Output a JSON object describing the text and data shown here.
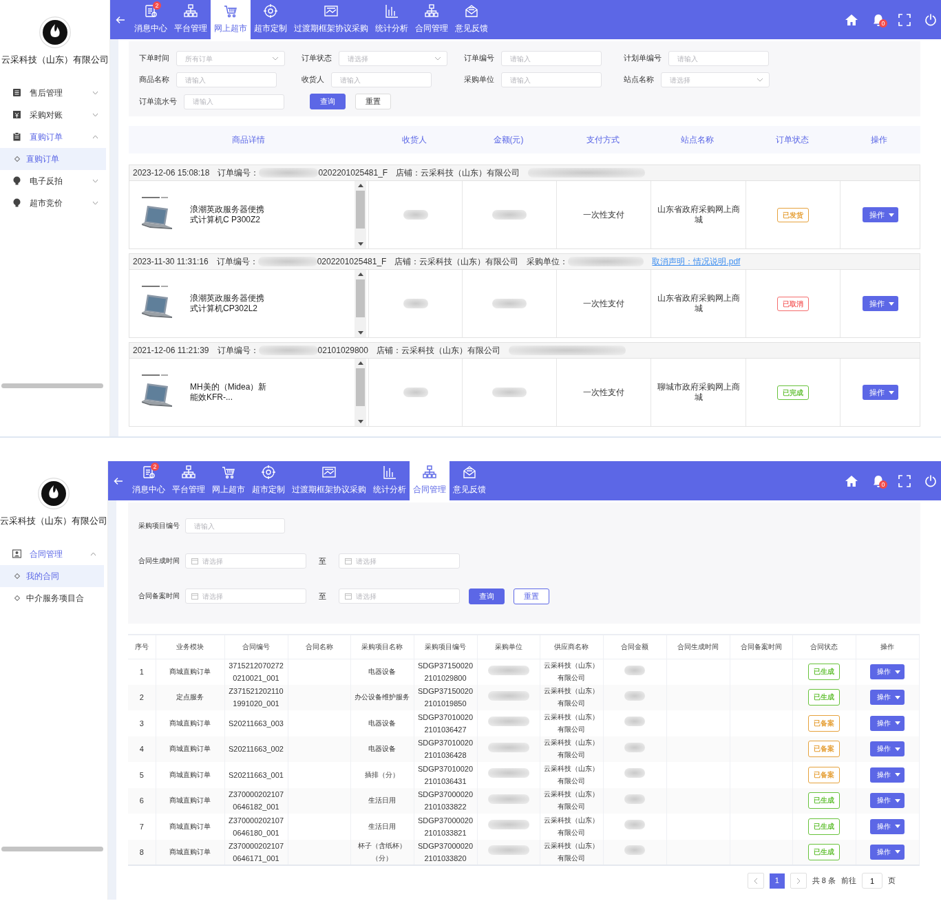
{
  "order_screen": {
    "sidebar": {
      "company": "云采科技（山东）有限公司",
      "menu": [
        {
          "label": "售后管理",
          "expanded": false
        },
        {
          "label": "采购对账",
          "expanded": false
        },
        {
          "label": "直购订单",
          "expanded": true,
          "children": [
            {
              "label": "直购订单",
              "selected": true
            }
          ]
        },
        {
          "label": "电子反拍",
          "expanded": false
        },
        {
          "label": "超市竞价",
          "expanded": false
        }
      ]
    },
    "nav": {
      "tabs": [
        {
          "label": "消息中心",
          "badge": "2",
          "selected": false
        },
        {
          "label": "平台管理",
          "selected": false
        },
        {
          "label": "网上超市",
          "selected": true
        },
        {
          "label": "超市定制",
          "selected": false
        },
        {
          "label": "过渡期框架协议采购",
          "selected": false
        },
        {
          "label": "统计分析",
          "selected": false
        },
        {
          "label": "合同管理",
          "selected": false
        },
        {
          "label": "意见反馈",
          "selected": false
        }
      ],
      "alert_badge": "0"
    },
    "filter_rows": [
      [
        {
          "label": "下单时间",
          "kind": "select",
          "placeholder": "所有订单"
        },
        {
          "label": "订单状态",
          "kind": "select",
          "placeholder": "请选择"
        },
        {
          "label": "订单编号",
          "kind": "text",
          "placeholder": "请输入"
        },
        {
          "label": "计划单编号",
          "kind": "text",
          "placeholder": "请输入"
        }
      ],
      [
        {
          "label": "商品名称",
          "kind": "text",
          "placeholder": "请输入"
        },
        {
          "label": "收货人",
          "kind": "text",
          "placeholder": "请输入"
        },
        {
          "label": "采购单位",
          "kind": "text",
          "placeholder": "请输入"
        },
        {
          "label": "站点名称",
          "kind": "select",
          "placeholder": "请选择"
        }
      ],
      [
        {
          "label": "订单流水号",
          "kind": "text",
          "placeholder": "请输入"
        }
      ]
    ],
    "buttons": [
      {
        "label": "查询",
        "kind": "primary"
      },
      {
        "label": "重置",
        "kind": "plain"
      }
    ],
    "columns": [
      "商品详情",
      "收货人",
      "金额(元)",
      "支付方式",
      "站点名称",
      "订单状态",
      "操作"
    ],
    "orders": [
      {
        "time": "2023-12-06 15:08:18",
        "order_no_label": "订单编号：",
        "order_no": "0202201025481_F",
        "shop": "店铺：云采科技（山东）有限公司",
        "product_name": "浪潮英政服务器便携式计算机C P300Z2",
        "payment": "一次性支付",
        "station": "山东省政府采购网上商城",
        "status": "已发货",
        "color": "#e6a23c",
        "action": "操作"
      },
      {
        "time": "2023-11-30 11:31:16",
        "order_no_label": "订单编号：",
        "order_no": "0202201025481_F",
        "shop": "店铺：云采科技（山东）有限公司",
        "buyer_label": "采购单位：",
        "notice_link": "取消声明：情况说明.pdf",
        "product_name": "浪潮英政服务器便携式计算机CP302L2",
        "payment": "一次性支付",
        "station": "山东省政府采购网上商城",
        "status": "已取消",
        "color": "#f56c6c",
        "action": "操作"
      },
      {
        "time": "2021-12-06 11:21:39",
        "order_no_label": "订单编号：",
        "order_no": "02101029800",
        "shop": "店铺：云采科技（山东）有限公司",
        "product_name": "MH美的（Midea）新能效KFR-...",
        "payment": "一次性支付",
        "station": "聊城市政府采购网上商城",
        "status": "已完成",
        "color": "#67c23a",
        "action": "操作"
      }
    ]
  },
  "contract_screen": {
    "sidebar": {
      "company": "云采科技（山东）有限公司",
      "menu": [
        {
          "label": "合同管理",
          "expanded": true,
          "children": [
            {
              "label": "我的合同",
              "selected": true
            },
            {
              "label": "中介服务项目合",
              "selected": false
            }
          ]
        }
      ]
    },
    "nav": {
      "tabs": [
        {
          "label": "消息中心",
          "badge": "2",
          "selected": false
        },
        {
          "label": "平台管理",
          "selected": false
        },
        {
          "label": "网上超市",
          "selected": false
        },
        {
          "label": "超市定制",
          "selected": false
        },
        {
          "label": "过渡期框架协议采购",
          "selected": false
        },
        {
          "label": "统计分析",
          "selected": false
        },
        {
          "label": "合同管理",
          "selected": true
        },
        {
          "label": "意见反馈",
          "selected": false
        }
      ],
      "alert_badge": "0"
    },
    "filters": [
      {
        "label": "采购项目编号",
        "kind": "text",
        "placeholder": "请输入"
      },
      {
        "label": "合同生成时间",
        "kind": "daterange",
        "from_placeholder": "请选择",
        "separator": "至",
        "to_placeholder": "请选择"
      },
      {
        "label": "合同备案时间",
        "kind": "daterange",
        "from_placeholder": "请选择",
        "separator": "至",
        "to_placeholder": "请选择"
      }
    ],
    "buttons": [
      {
        "label": "查询",
        "kind": "primary"
      },
      {
        "label": "重置",
        "kind": "outline"
      }
    ],
    "columns": [
      "序号",
      "业务模块",
      "合同编号",
      "合同名称",
      "采购项目名称",
      "采购项目编号",
      "采购单位",
      "供应商名称",
      "合同金额",
      "合同生成时间",
      "合同备案时间",
      "合同状态",
      "操作"
    ],
    "rows": [
      {
        "no": "1",
        "module": "商城直购订单",
        "contract_no": "37152120702720210021_001",
        "project_name": "电器设备",
        "project_no": "SDGP371500202101029800",
        "supplier": "云采科技（山东）有限公司",
        "status": "已生成",
        "color": "#67c23a",
        "action": "操作"
      },
      {
        "no": "2",
        "module": "定点服务",
        "contract_no": "Z3715212021101991020_001",
        "project_name": "办公设备维护服务",
        "project_no": "SDGP371500202101019850",
        "supplier": "云采科技（山东）有限公司",
        "status": "已生成",
        "color": "#67c23a",
        "action": "操作"
      },
      {
        "no": "3",
        "module": "商城直购订单",
        "contract_no": "S20211663_003",
        "project_name": "电器设备",
        "project_no": "SDGP370100202101036427",
        "supplier": "云采科技（山东）有限公司",
        "status": "已备案",
        "color": "#e6a23c",
        "action": "操作"
      },
      {
        "no": "4",
        "module": "商城直购订单",
        "contract_no": "S20211663_002",
        "project_name": "电器设备",
        "project_no": "SDGP370100202101036428",
        "supplier": "云采科技（山东）有限公司",
        "status": "已备案",
        "color": "#e6a23c",
        "action": "操作"
      },
      {
        "no": "5",
        "module": "商城直购订单",
        "contract_no": "S20211663_001",
        "project_name": "插排（分）",
        "project_no": "SDGP370100202101036431",
        "supplier": "云采科技（山东）有限公司",
        "status": "已备案",
        "color": "#e6a23c",
        "action": "操作"
      },
      {
        "no": "6",
        "module": "商城直购订单",
        "contract_no": "Z3700002021070646182_001",
        "project_name": "生活日用",
        "project_no": "SDGP370000202101033822",
        "supplier": "云采科技（山东）有限公司",
        "status": "已生成",
        "color": "#67c23a",
        "action": "操作"
      },
      {
        "no": "7",
        "module": "商城直购订单",
        "contract_no": "Z3700002021070646180_001",
        "project_name": "生活日用",
        "project_no": "SDGP370000202101033821",
        "supplier": "云采科技（山东）有限公司",
        "status": "已生成",
        "color": "#67c23a",
        "action": "操作"
      },
      {
        "no": "8",
        "module": "商城直购订单",
        "contract_no": "Z3700002021070646171_001",
        "project_name": "杯子（含纸杯）（分）",
        "project_no": "SDGP370000202101033820",
        "supplier": "云采科技（山东）有限公司",
        "status": "已生成",
        "color": "#67c23a",
        "action": "操作"
      }
    ],
    "pagination": {
      "pages": [
        {
          "label": "1",
          "selected": true
        }
      ],
      "total": "共 8 条",
      "goto_label": "前往",
      "page_value": "1",
      "page_suffix": "页"
    }
  }
}
